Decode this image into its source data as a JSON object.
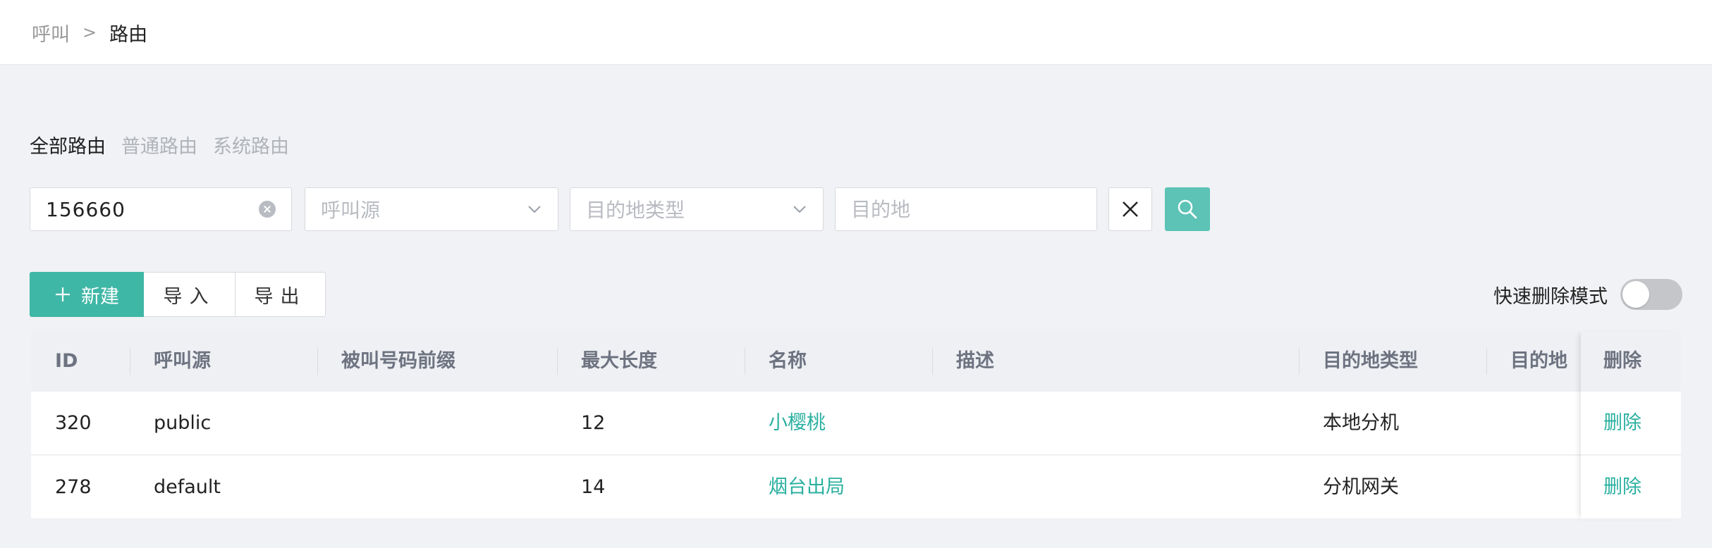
{
  "breadcrumb": {
    "parent": "呼叫",
    "separator": ">",
    "current": "路由"
  },
  "tabs": [
    {
      "label": "全部路由",
      "active": true
    },
    {
      "label": "普通路由",
      "active": false
    },
    {
      "label": "系统路由",
      "active": false
    }
  ],
  "filters": {
    "search_value": "156660",
    "caller_source_placeholder": "呼叫源",
    "dest_type_placeholder": "目的地类型",
    "destination_placeholder": "目的地"
  },
  "actions": {
    "new_label": "新建",
    "new_icon": "plus-icon",
    "import_label": "导入",
    "export_label": "导出"
  },
  "quick_delete": {
    "label": "快速删除模式",
    "enabled": false
  },
  "table": {
    "headers": {
      "id": "ID",
      "source": "呼叫源",
      "prefix": "被叫号码前缀",
      "max_length": "最大长度",
      "name": "名称",
      "desc": "描述",
      "dest_type": "目的地类型",
      "dest": "目的地",
      "delete": "删除"
    },
    "rows": [
      {
        "id": "320",
        "source": "public",
        "prefix": "",
        "max_length": "12",
        "name": "小樱桃",
        "desc": "",
        "dest_type": "本地分机",
        "dest": "",
        "delete": "删除"
      },
      {
        "id": "278",
        "source": "default",
        "prefix": "",
        "max_length": "14",
        "name": "烟台出局",
        "desc": "",
        "dest_type": "分机网关",
        "dest": "",
        "delete": "删除"
      }
    ]
  },
  "colors": {
    "primary": "#3fb7a6",
    "link": "#2ab0a0",
    "search_button": "#5cc3b6"
  }
}
